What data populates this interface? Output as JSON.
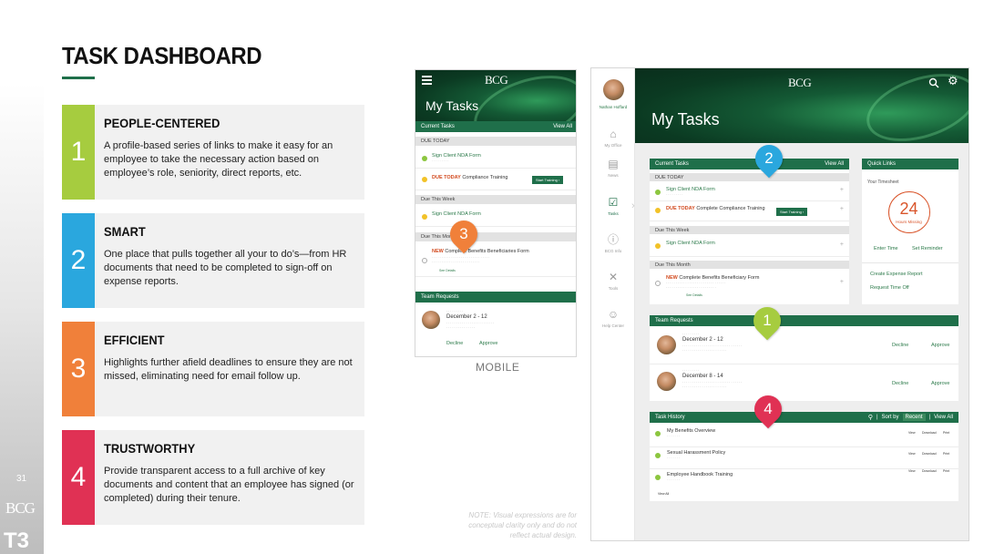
{
  "slide": {
    "title": "TASK DASHBOARD",
    "page_number": "31",
    "brand": "BCG",
    "brand_sub": "T3",
    "accent": "#1f6f4a",
    "features": [
      {
        "number": "1",
        "title": "PEOPLE-CENTERED",
        "desc": "A profile-based series of links to make it easy for an employee to take the necessary action based on employee’s role, seniority, direct reports, etc.",
        "color": "#a6cc3f"
      },
      {
        "number": "2",
        "title": "SMART",
        "desc": "One place that pulls together all your to do’s—from HR documents that need to be completed to sign-off on expense reports.",
        "color": "#2aa7de"
      },
      {
        "number": "3",
        "title": "EFFICIENT",
        "desc": "Highlights further afield deadlines to ensure they are not missed, eliminating need for email follow up.",
        "color": "#f0803a"
      },
      {
        "number": "4",
        "title": "TRUSTWORTHY",
        "desc": "Provide transparent access to a full archive of key documents and content that an employee has signed (or completed) during their tenure.",
        "color": "#e03154"
      }
    ],
    "mobile_caption": "MOBILE",
    "note": "NOTE: Visual expressions are for conceptual clarity only and do not reflect actual design."
  },
  "mobile": {
    "logo": "BCG",
    "menu_icon": "hamburger-icon",
    "page_title": "My Tasks",
    "current_tasks": "Current Tasks",
    "view_all": "View All",
    "due_today": "DUE TODAY",
    "task1": "Sign Client NDA Form",
    "task2_tag": "DUE TODAY",
    "task2": "Compliance Training",
    "start_training": "Start Training",
    "due_week": "Due This Week",
    "task3": "Sign Client NDA Form",
    "due_month": "Due This Month",
    "task4_tag": "NEW",
    "task4": "Complete Benefits Beneficiaries Form",
    "see_details": "See Details",
    "team_requests": "Team Requests",
    "req_date": "December 2 - 12",
    "decline": "Decline",
    "approve": "Approve",
    "pin": "3"
  },
  "desktop": {
    "logo": "BCG",
    "user_name": "Nathan Hoffard",
    "search_icon": "search-icon",
    "settings_icon": "gear-icon",
    "page_title": "My Tasks",
    "nav": [
      "My Office",
      "News",
      "Tasks",
      "BCG Info",
      "Tools",
      "Help Center"
    ],
    "current_tasks": "Current Tasks",
    "view_all": "View All",
    "due_today": "DUE TODAY",
    "task1": "Sign Client NDA Form",
    "task2_tag": "DUE TODAY",
    "task2": "Complete Compliance Training",
    "start_training": "Start Training",
    "due_week": "Due This Week",
    "task3": "Sign Client NDA Form",
    "due_month": "Due This Month",
    "task4_tag": "NEW",
    "task4": "Complete Benefits Beneficiary Form",
    "see_details": "See Details",
    "quick_links": "Quick Links",
    "your_timesheet": "Your Timesheet",
    "hours_missing_value": "24",
    "hours_missing_label": "Hours Missing",
    "enter_time": "Enter Time",
    "set_reminder": "Set Reminder",
    "create_expense": "Create Expense Report",
    "request_time_off": "Request Time Off",
    "team_requests": "Team Requests",
    "req1_date": "December 2 - 12",
    "req2_date": "December 8 - 14",
    "decline": "Decline",
    "approve": "Approve",
    "task_history": "Task History",
    "sort_by": "Sort by",
    "recent": "Recent",
    "history_view_all": "View All",
    "history": [
      "My Benefits Overview",
      "Sexual Harassment Policy",
      "Employee Handbook Training"
    ],
    "history_actions": [
      "View",
      "Download",
      "Print"
    ],
    "history_view_all_bottom": "View All",
    "pins": [
      "2",
      "1",
      "4"
    ]
  }
}
